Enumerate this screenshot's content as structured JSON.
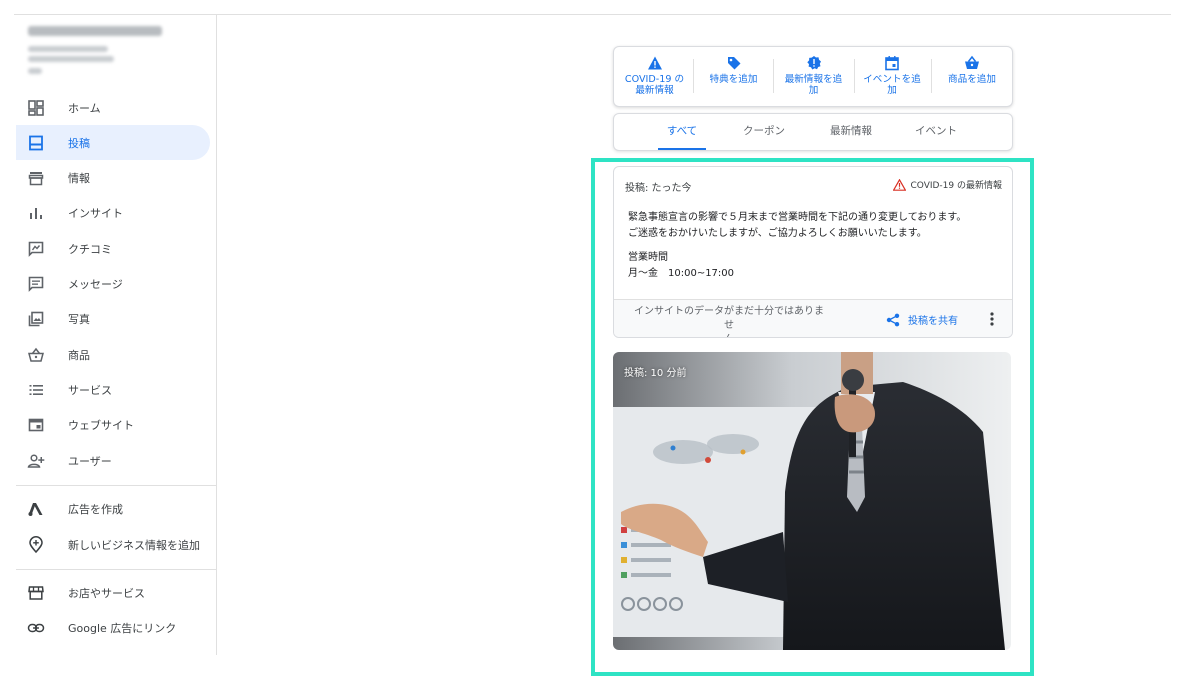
{
  "sidebar": {
    "items": [
      {
        "label": "ホーム",
        "icon": "dashboard-icon"
      },
      {
        "label": "投稿",
        "icon": "post-icon",
        "active": true
      },
      {
        "label": "情報",
        "icon": "storefront-icon"
      },
      {
        "label": "インサイト",
        "icon": "insights-icon"
      },
      {
        "label": "クチコミ",
        "icon": "review-icon"
      },
      {
        "label": "メッセージ",
        "icon": "message-icon"
      },
      {
        "label": "写真",
        "icon": "photo-icon"
      },
      {
        "label": "商品",
        "icon": "basket-icon"
      },
      {
        "label": "サービス",
        "icon": "list-icon"
      },
      {
        "label": "ウェブサイト",
        "icon": "website-icon"
      },
      {
        "label": "ユーザー",
        "icon": "add-user-icon"
      }
    ],
    "extra": [
      {
        "label": "広告を作成",
        "icon": "google-ads-icon"
      },
      {
        "label": "新しいビジネス情報を追加",
        "icon": "add-location-icon"
      }
    ],
    "bottom": [
      {
        "label": "お店やサービス",
        "icon": "store-icon"
      },
      {
        "label": "Google 広告にリンク",
        "icon": "link-icon"
      }
    ]
  },
  "actions": [
    {
      "label1": "COVID-19 の",
      "label2": "最新情報",
      "icon": "warning-icon"
    },
    {
      "label1": "特典を追加",
      "label2": "",
      "icon": "tag-icon"
    },
    {
      "label1": "最新情報を追",
      "label2": "加",
      "icon": "update-icon"
    },
    {
      "label1": "イベントを追",
      "label2": "加",
      "icon": "calendar-icon"
    },
    {
      "label1": "商品を追加",
      "label2": "",
      "icon": "basket-icon"
    }
  ],
  "tabs": [
    {
      "label": "すべて",
      "active": true
    },
    {
      "label": "クーポン"
    },
    {
      "label": "最新情報"
    },
    {
      "label": "イベント"
    }
  ],
  "post": {
    "meta": "投稿: たった今",
    "badge": "COVID-19 の最新情報",
    "line1": "緊急事態宣言の影響で５月末まで営業時間を下記の通り変更しております。",
    "line2": "ご迷惑をおかけいたしますが、ご協力よろしくお願いいたします。",
    "hours_title": "営業時間",
    "hours": "月～金　10:00~17:00",
    "insight_line1": "インサイトのデータがまだ十分ではありませ",
    "insight_line2": "ん",
    "share": "投稿を共有"
  },
  "photo_post": {
    "meta": "投稿: 10 分前"
  },
  "colors": {
    "accent": "#1a73e8",
    "highlight": "#2ee3c4",
    "warning": "#d93025"
  }
}
